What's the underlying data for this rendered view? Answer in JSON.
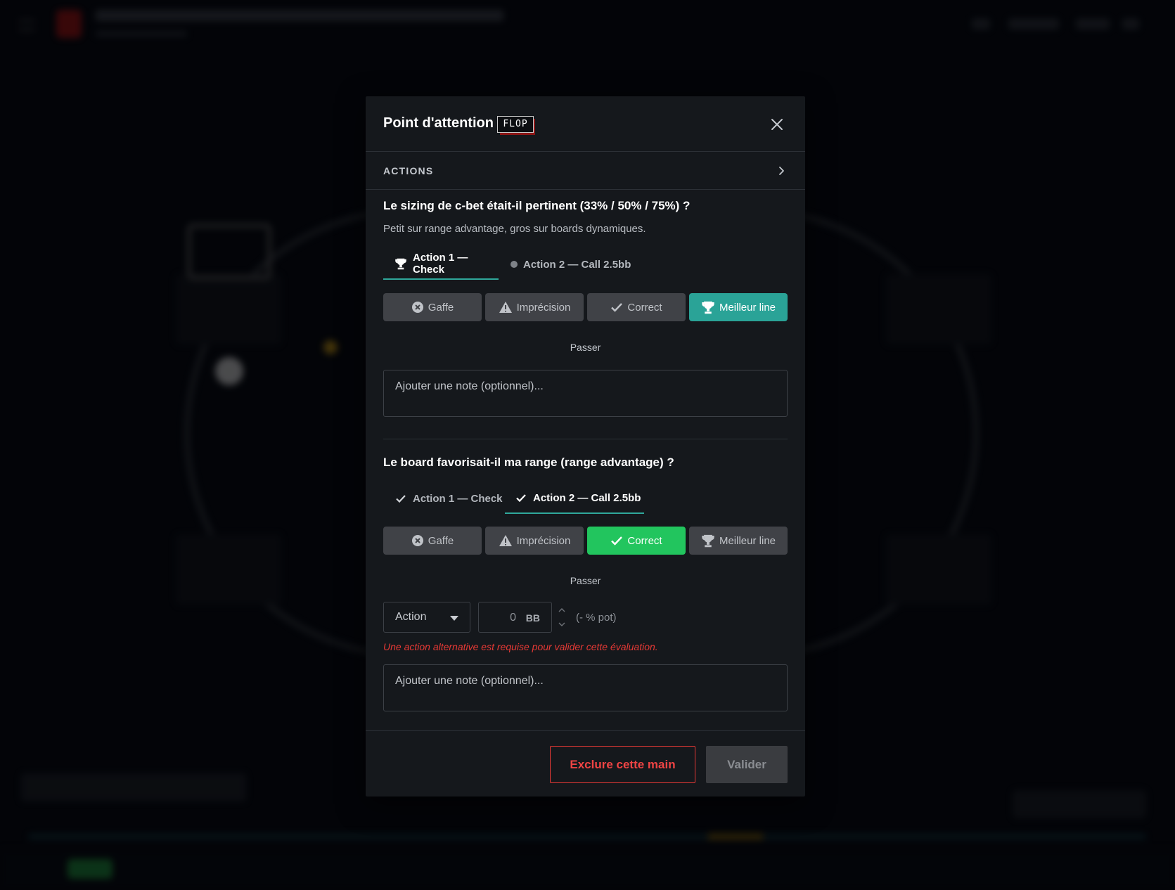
{
  "modal": {
    "title": "Point d'attention",
    "street_badge": "FLOP",
    "actions_section_label": "ACTIONS"
  },
  "questions": [
    {
      "title": "Le sizing de c-bet était-il pertinent (33% / 50% / 75%) ?",
      "description": "Petit sur range advantage, gros sur boards dynamiques.",
      "tabs": [
        {
          "label": "Action 1 — Check",
          "icon": "trophy-icon",
          "active": true
        },
        {
          "label": "Action 2 — Call 2.5bb",
          "icon": "dot-icon",
          "active": false
        }
      ],
      "ratings": [
        {
          "label": "Gaffe",
          "icon": "x-circle-icon",
          "selected": false
        },
        {
          "label": "Imprécision",
          "icon": "warning-icon",
          "selected": false
        },
        {
          "label": "Correct",
          "icon": "check-icon",
          "selected": false
        },
        {
          "label": "Meilleur line",
          "icon": "trophy-icon",
          "selected": true
        }
      ],
      "skip_label": "Passer",
      "note_placeholder": "Ajouter une note (optionnel)..."
    },
    {
      "title": "Le board favorisait-il ma range (range advantage) ?",
      "tabs": [
        {
          "label": "Action 1 — Check",
          "icon": "check-icon",
          "active": false
        },
        {
          "label": "Action 2 — Call 2.5bb",
          "icon": "check-icon",
          "active": true
        }
      ],
      "ratings": [
        {
          "label": "Gaffe",
          "icon": "x-circle-icon",
          "selected": false
        },
        {
          "label": "Imprécision",
          "icon": "warning-icon",
          "selected": false
        },
        {
          "label": "Correct",
          "icon": "check-icon",
          "selected": true
        },
        {
          "label": "Meilleur line",
          "icon": "trophy-icon",
          "selected": false
        }
      ],
      "skip_label": "Passer",
      "alternative": {
        "action_select": "Action",
        "amount_value": "0",
        "amount_unit": "BB",
        "pot_percent": "(- % pot)",
        "error": "Une action alternative est requise pour valider cette évaluation."
      },
      "note_placeholder": "Ajouter une note (optionnel)..."
    }
  ],
  "footer": {
    "exclude_label": "Exclure cette main",
    "validate_label": "Valider"
  },
  "colors": {
    "teal_selected": "#2aa397",
    "green_selected": "#22c55e",
    "danger": "#e53935",
    "modal_bg": "#15181c"
  }
}
